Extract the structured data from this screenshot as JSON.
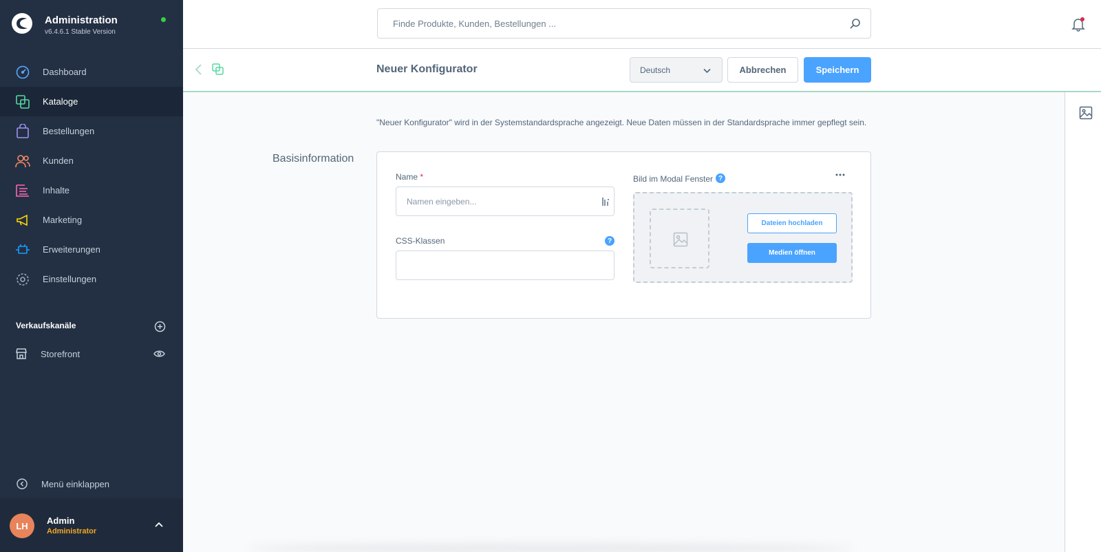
{
  "brand": {
    "title": "Administration",
    "version": "v6.4.6.1 Stable Version"
  },
  "nav": {
    "items": [
      {
        "label": "Dashboard",
        "icon": "dashboard-icon",
        "color": "#5aa8ff"
      },
      {
        "label": "Kataloge",
        "icon": "catalog-icon",
        "color": "#57d9a3",
        "active": true
      },
      {
        "label": "Bestellungen",
        "icon": "orders-icon",
        "color": "#a092f0"
      },
      {
        "label": "Kunden",
        "icon": "customers-icon",
        "color": "#f88962"
      },
      {
        "label": "Inhalte",
        "icon": "content-icon",
        "color": "#ff68b4"
      },
      {
        "label": "Marketing",
        "icon": "marketing-icon",
        "color": "#ffd700"
      },
      {
        "label": "Erweiterungen",
        "icon": "extensions-icon",
        "color": "#189eff"
      },
      {
        "label": "Einstellungen",
        "icon": "settings-icon",
        "color": "#9aa8b5"
      }
    ]
  },
  "sales_channels": {
    "heading": "Verkaufskanäle",
    "storefront_label": "Storefront"
  },
  "collapse_label": "Menü einklappen",
  "user": {
    "initials": "LH",
    "name": "Admin",
    "role": "Administrator"
  },
  "search": {
    "placeholder": "Finde Produkte, Kunden, Bestellungen ..."
  },
  "header": {
    "title": "Neuer Konfigurator",
    "language": "Deutsch",
    "cancel_label": "Abbrechen",
    "save_label": "Speichern"
  },
  "notice": "\"Neuer Konfigurator\" wird in der Systemstandardsprache angezeigt. Neue Daten müssen in der Standardsprache immer gepflegt sein.",
  "form": {
    "section_label": "Basisinformation",
    "name_label": "Name",
    "name_required_mark": "*",
    "name_placeholder": "Namen eingeben...",
    "name_value": "",
    "css_label": "CSS-Klassen",
    "css_value": "",
    "image_label": "Bild im Modal Fenster",
    "help_glyph": "?",
    "upload_label": "Dateien hochladen",
    "media_label": "Medien öffnen"
  },
  "colors": {
    "sidebar_bg": "#233043",
    "accent": "#4aa3ff",
    "header_underline": "#a6d9c3"
  }
}
